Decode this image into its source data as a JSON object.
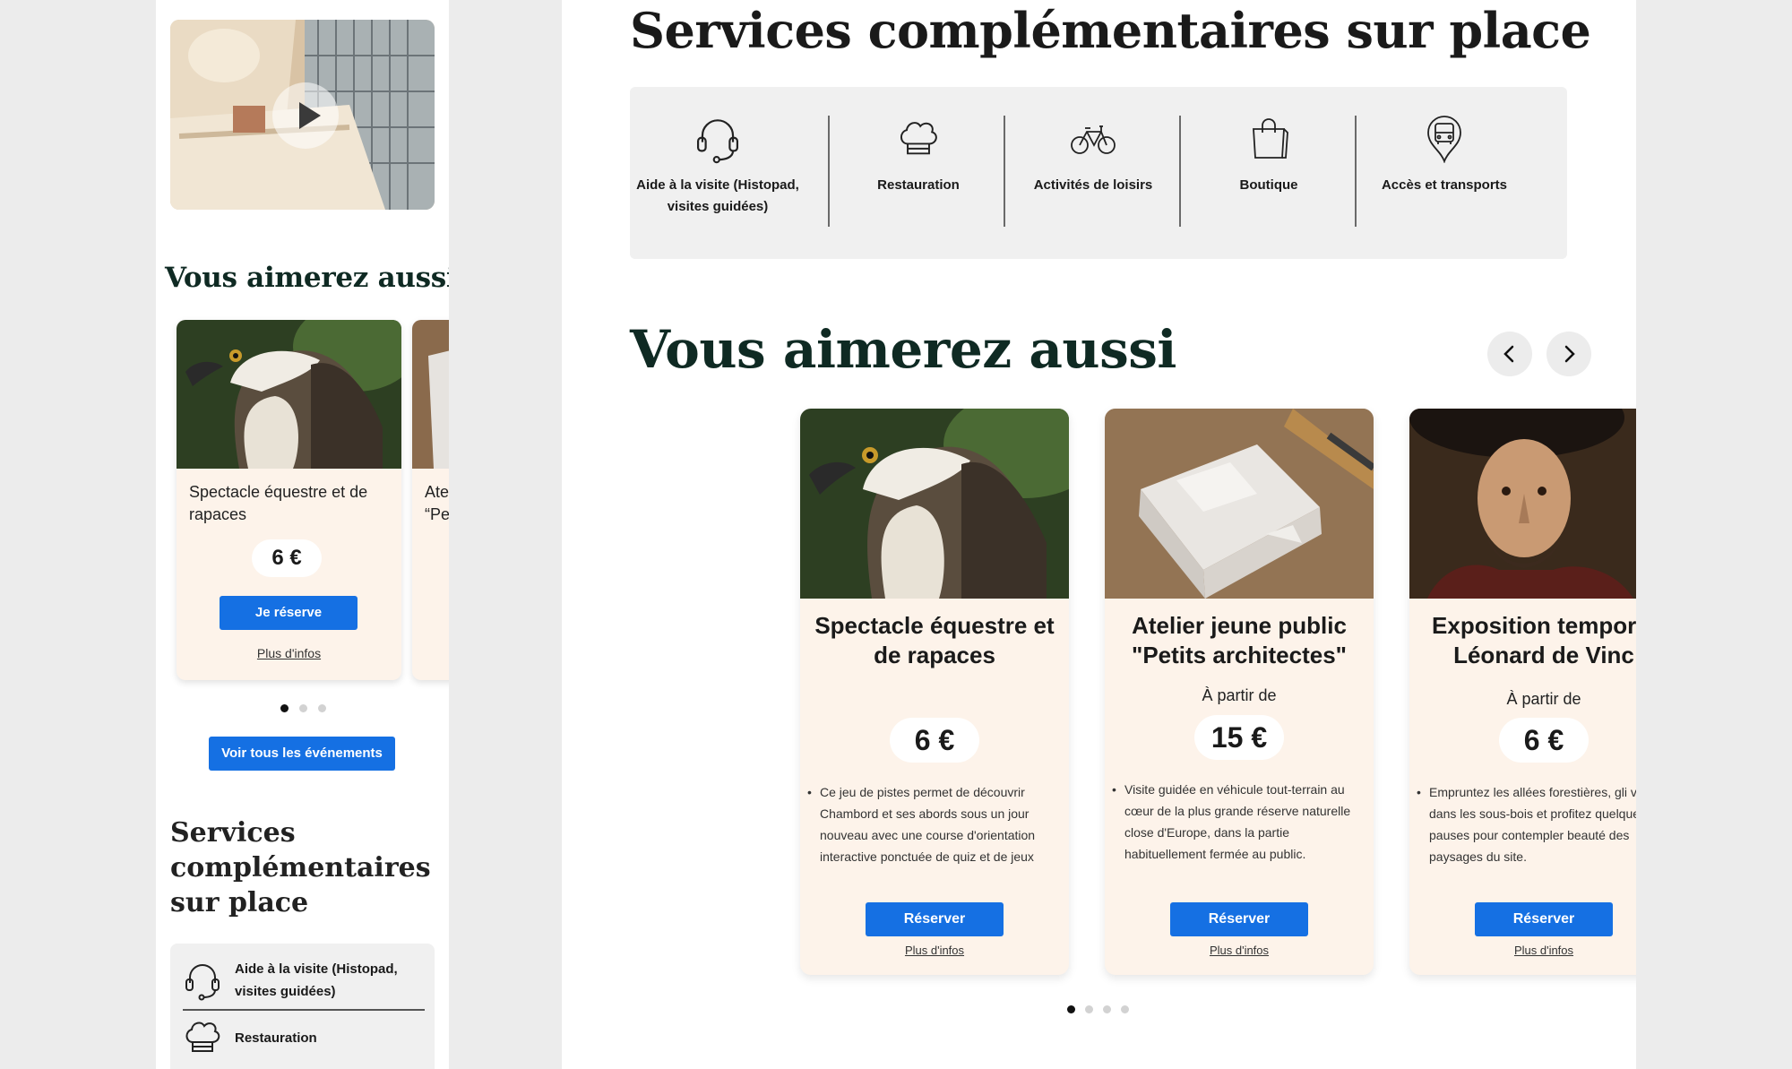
{
  "mobile": {
    "heading": "Vous aimerez aussi",
    "cards": [
      {
        "title": "Spectacle équestre et de rapaces",
        "price": "6 €",
        "button": "Je réserve",
        "link": "Plus d'infos"
      },
      {
        "title_partial_1": "Ate",
        "title_partial_2": "“Pe"
      }
    ],
    "all_events_button": "Voir tous les événements",
    "services_title": "Services complémentaires sur place",
    "services": [
      {
        "label": "Aide à la visite (Histopad, visites guidées)",
        "icon": "headset-icon"
      },
      {
        "label": "Restauration",
        "icon": "chef-hat-icon"
      }
    ]
  },
  "desktop": {
    "services_title": "Services complémentaires sur place",
    "services": [
      {
        "label": "Aide à la visite (Histopad, visites guidées)",
        "icon": "headset-icon"
      },
      {
        "label": "Restauration",
        "icon": "chef-hat-icon"
      },
      {
        "label": "Activités de loisirs",
        "icon": "bicycle-icon"
      },
      {
        "label": "Boutique",
        "icon": "shopping-bag-icon"
      },
      {
        "label": "Accès et transports",
        "icon": "bus-location-icon"
      }
    ],
    "heading": "Vous aimerez aussi",
    "cards": [
      {
        "title": "Spectacle équestre et de rapaces",
        "from": "",
        "price": "6 €",
        "description": "Ce jeu de pistes permet de découvrir Chambord et ses abords sous un jour nouveau avec une course d'orientation interactive ponctuée de quiz et de jeux",
        "button": "Réserver",
        "link": "Plus d'infos"
      },
      {
        "title": "Atelier jeune public \"Petits architectes\"",
        "from": "À partir de",
        "price": "15 €",
        "description": "Visite guidée en véhicule tout-terrain au cœur de la plus grande réserve naturelle close d'Europe, dans la partie habituellement fermée au public.",
        "button": "Réserver",
        "link": "Plus d'infos"
      },
      {
        "title": "Exposition temporai Léonard de Vinc",
        "from": "À partir de",
        "price": "6 €",
        "description": "Empruntez les allées forestières, gli vous dans les sous-bois et profitez quelques pauses pour contempler beauté des paysages du site.",
        "button": "Réserver",
        "link": "Plus d'infos"
      }
    ]
  },
  "colors": {
    "accent_blue": "#1570e3",
    "card_background": "#fdf3ea",
    "heading_green": "#0f2a23",
    "services_background": "#f0f0f0"
  }
}
